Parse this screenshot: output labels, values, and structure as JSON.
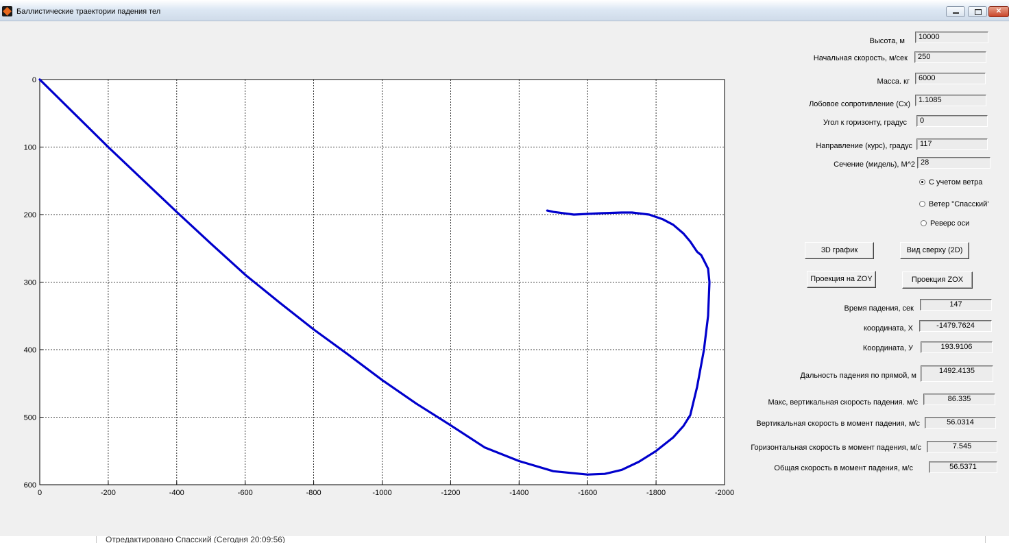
{
  "window": {
    "title": "Баллистические траектории падения тел"
  },
  "chart_data": {
    "type": "line",
    "title": "",
    "xlabel": "",
    "ylabel": "",
    "xlim": [
      0,
      -2000
    ],
    "ylim": [
      0,
      600
    ],
    "x_reversed": true,
    "y_reversed": true,
    "grid": true,
    "x_ticks": [
      "0",
      "-200",
      "-400",
      "-600",
      "-800",
      "-1000",
      "-1200",
      "-1400",
      "-1600",
      "-1800",
      "-2000"
    ],
    "y_ticks": [
      "0",
      "100",
      "200",
      "300",
      "400",
      "500",
      "600"
    ],
    "series": [
      {
        "color": "#0000cc",
        "x": [
          0,
          -100,
          -200,
          -300,
          -400,
          -500,
          -600,
          -700,
          -800,
          -900,
          -1000,
          -1100,
          -1200,
          -1300,
          -1400,
          -1500,
          -1600,
          -1650,
          -1700,
          -1750,
          -1800,
          -1850,
          -1880,
          -1900,
          -1920,
          -1940,
          -1952,
          -1956,
          -1952,
          -1942,
          -1932,
          -1920,
          -1900,
          -1880,
          -1850,
          -1820,
          -1780,
          -1730,
          -1700,
          -1640,
          -1600,
          -1560,
          -1500,
          -1482
        ],
        "y": [
          0,
          50,
          100,
          148,
          196,
          243,
          289,
          330,
          370,
          407,
          445,
          480,
          512,
          545,
          565,
          580,
          585,
          584,
          578,
          566,
          550,
          530,
          513,
          497,
          455,
          400,
          350,
          300,
          280,
          270,
          260,
          255,
          240,
          228,
          215,
          207,
          200,
          197,
          197,
          198,
          199,
          200,
          196,
          194
        ]
      }
    ]
  },
  "inputs": {
    "height": {
      "label": "Высота, м",
      "value": "10000"
    },
    "speed": {
      "label": "Начальная скорость, м/сек",
      "value": "250"
    },
    "mass": {
      "label": "Масса. кг",
      "value": "6000"
    },
    "drag": {
      "label": "Лобовое сопротивление (Cx)",
      "value": "1.1085"
    },
    "angle": {
      "label": "Угол к горизонту, градус",
      "value": "0"
    },
    "course": {
      "label": "Направление  (курс), градус",
      "value": "117"
    },
    "section": {
      "label": "Сечение (мидель), М^2",
      "value": "28"
    }
  },
  "radios": [
    {
      "label": "С учетом ветра",
      "checked": true
    },
    {
      "label": "Ветер \"Спасский'",
      "checked": false
    },
    {
      "label": "Реверс оси",
      "checked": false
    }
  ],
  "buttons": {
    "plot3d": "3D график",
    "top_view": "Вид сверху (2D)",
    "proj_zoy": "Проекция на ZOY",
    "proj_zox": "Проекция ZOX"
  },
  "results": {
    "fall_time": {
      "label": "Время падения, сек",
      "value": "147"
    },
    "coord_x": {
      "label": "координата, Х",
      "value": "-1479.7624"
    },
    "coord_y": {
      "label": "Координата, У",
      "value": "193.9106"
    },
    "distance": {
      "label": "Дальность падения по прямой, м",
      "value": "1492.4135"
    },
    "max_vspeed": {
      "label": "Макс,  вертикальная скорость падения. м/с",
      "value": "86.335"
    },
    "vspeed_impact": {
      "label": "Вертикальная  скорость в момент падения, м/с",
      "value": "56.0314"
    },
    "hspeed_impact": {
      "label": "Горизонтальная скорость в момент падения, м/с",
      "value": "7.545"
    },
    "total_speed": {
      "label": "Общая скорость в момент падения, м/с",
      "value": "56.5371"
    }
  },
  "status": {
    "text": "Отредактировано Спасский (Сегодня 20:09:56)"
  }
}
